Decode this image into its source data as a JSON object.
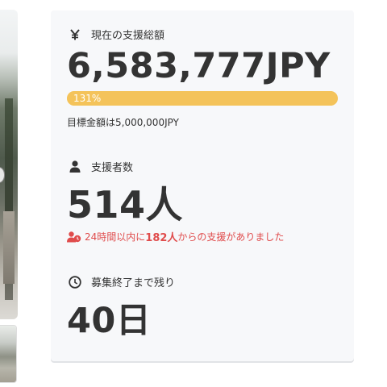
{
  "total": {
    "icon": "yen-icon",
    "label": "現在の支援総額",
    "amount": "6,583,777JPY",
    "progress_percent": 131,
    "progress_label": "131%",
    "goal_text": "目標金額は5,000,000JPY"
  },
  "supporters": {
    "icon": "person-icon",
    "label": "支援者数",
    "count": "514人",
    "recent": {
      "prefix": "24時間以内に",
      "number": "182人",
      "suffix": "からの支援がありました"
    }
  },
  "remaining": {
    "icon": "clock-icon",
    "label": "募集終了まで残り",
    "days": "40日"
  },
  "colors": {
    "progress": "#f6c861",
    "recent_text": "#e04c4c",
    "card_bg": "#f7f8fa"
  }
}
